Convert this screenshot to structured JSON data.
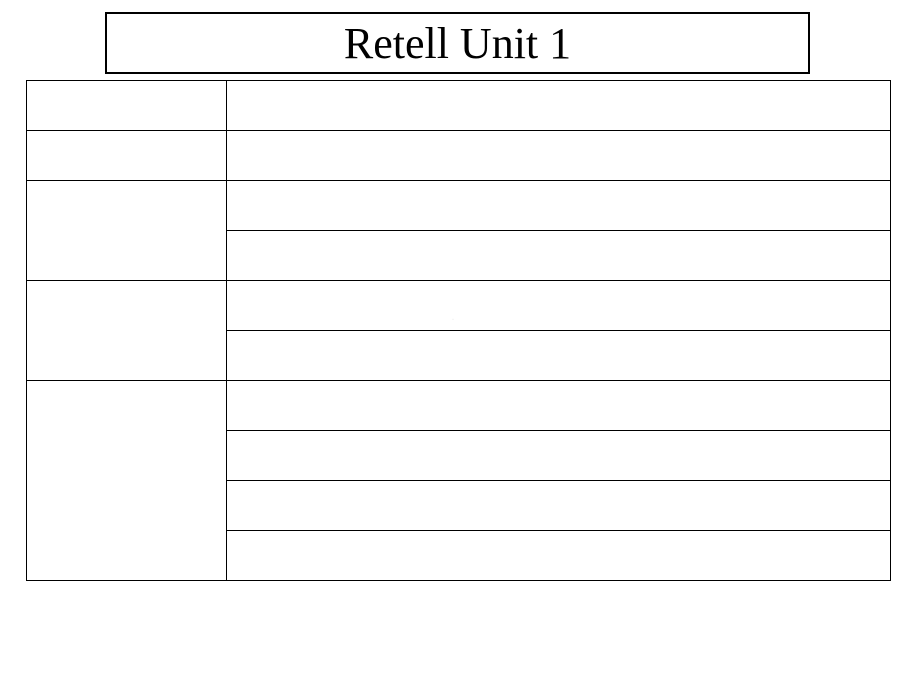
{
  "title": "Retell Unit 1",
  "rows": [
    {
      "left": "",
      "right": [
        ""
      ]
    },
    {
      "left": "",
      "right": [
        ""
      ]
    },
    {
      "left": "",
      "right": [
        "",
        ""
      ]
    },
    {
      "left": "",
      "right": [
        "",
        ""
      ]
    },
    {
      "left": "",
      "right": [
        "",
        "",
        "",
        ""
      ]
    }
  ],
  "center_mark": "."
}
